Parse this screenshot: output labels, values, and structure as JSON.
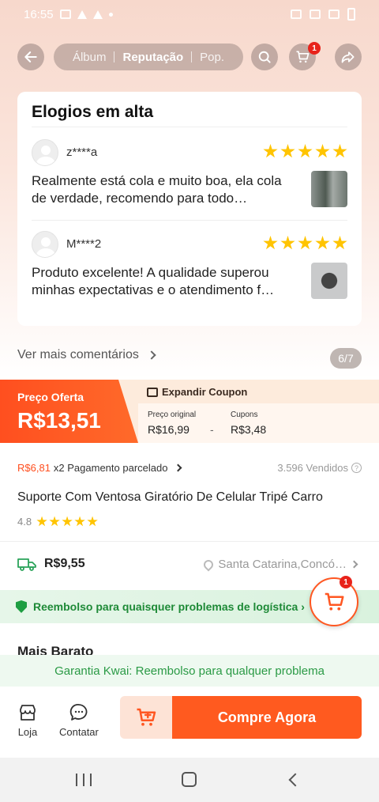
{
  "status_bar": {
    "time": "16:55"
  },
  "header": {
    "tabs": [
      "Álbum",
      "Reputação",
      "Pop."
    ],
    "active_tab": "Reputação",
    "cart_badge": "1"
  },
  "praise": {
    "title": "Elogios em alta",
    "reviews": [
      {
        "user": "z****a",
        "stars": 5,
        "text": "Realmente está cola e muito boa, ela cola de verdade, recomendo para todo…"
      },
      {
        "user": "M****2",
        "stars": 5,
        "text": "Produto excelente! A qualidade superou minhas expectativas e o atendimento f…"
      }
    ],
    "more_comments": "Ver mais comentários",
    "page_counter": "6/7"
  },
  "offer": {
    "label": "Preço Oferta",
    "price": "R$13,51",
    "coupon_header": "Expandir Coupon",
    "original_label": "Preço original",
    "original_price": "R$16,99",
    "minus": "-",
    "coupons_label": "Cupons",
    "coupons_value": "R$3,48"
  },
  "product": {
    "installment_price": "R$6,81",
    "installment_text": "x2 Pagamento parcelado",
    "sold": "3.596 Vendidos",
    "title": "Suporte Com Ventosa Giratório De Celular Tripé Carro",
    "rating": "4.8",
    "rating_stars": 5,
    "shipping_price": "R$9,55",
    "location": "Santa Catarina,Concó…"
  },
  "refund_banner": "Reembolso para quaisquer problemas de logística ›",
  "float_cart_badge": "1",
  "cheaper_title": "Mais Barato",
  "guarantee": "Garantia Kwai: Reembolso para qualquer problema",
  "bottom_bar": {
    "loja": "Loja",
    "contatar": "Contatar",
    "buy": "Compre Agora"
  },
  "colors": {
    "accent": "#ff5a1f",
    "star": "#ffc400",
    "green": "#1e8a37"
  }
}
